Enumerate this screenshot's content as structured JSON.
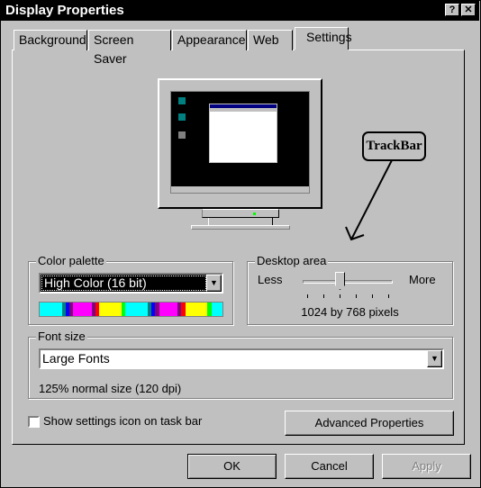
{
  "window": {
    "title": "Display Properties",
    "help_label": "?",
    "close_label": "✕"
  },
  "tabs": [
    {
      "label": "Background"
    },
    {
      "label": "Screen Saver"
    },
    {
      "label": "Appearance"
    },
    {
      "label": "Web"
    },
    {
      "label": "Settings",
      "selected": true
    }
  ],
  "annotation": {
    "label": "TrackBar"
  },
  "color_palette": {
    "label": "Color palette",
    "selected": "High Color (16 bit)",
    "swatch_colors": [
      "#00ffff",
      "#008080",
      "#0000ff",
      "#800080",
      "#ff00ff",
      "#800080",
      "#ff0000",
      "#ffff00",
      "#00ff00",
      "#00ffff",
      "#008080",
      "#0000ff",
      "#800080",
      "#ff00ff",
      "#800080",
      "#ff0000",
      "#ffff00",
      "#00ff00",
      "#00ffff"
    ]
  },
  "desktop_area": {
    "label": "Desktop area",
    "less_label": "Less",
    "more_label": "More",
    "tick_count": 6,
    "selected_tick": 3,
    "value_text": "1024 by 768 pixels"
  },
  "font_size": {
    "label": "Font size",
    "selected": "Large Fonts",
    "info": "125% normal size (120 dpi)"
  },
  "show_settings_icon": {
    "label": "Show settings icon on task bar",
    "checked": false
  },
  "buttons": {
    "advanced": "Advanced Properties",
    "ok": "OK",
    "cancel": "Cancel",
    "apply": "Apply"
  }
}
